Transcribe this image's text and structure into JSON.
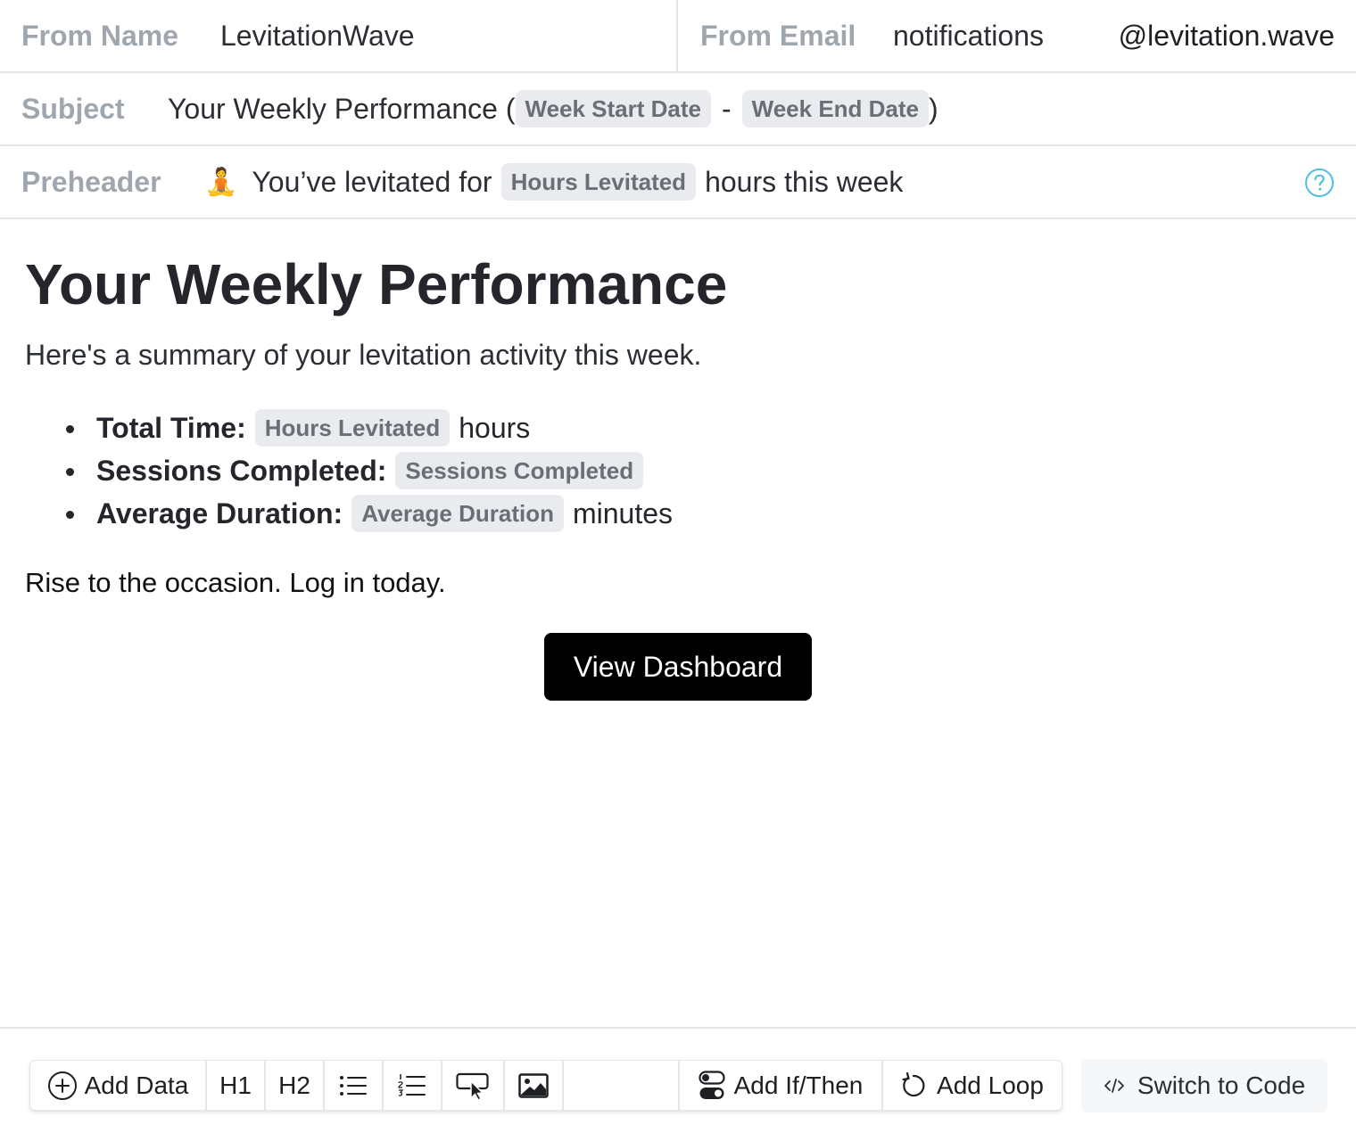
{
  "from": {
    "name_label": "From Name",
    "name_value": "LevitationWave",
    "email_label": "From Email",
    "email_local": "notifications",
    "email_domain": "@levitation.wave"
  },
  "subject": {
    "label": "Subject",
    "prefix": "Your Weekly Performance (",
    "chip_start": "Week Start Date",
    "separator": "-",
    "chip_end": "Week End Date",
    "suffix": ")"
  },
  "preheader": {
    "label": "Preheader",
    "emoji": "🧘",
    "prefix": "You’ve levitated for",
    "chip": "Hours Levitated",
    "suffix": "hours this week"
  },
  "body": {
    "heading": "Your Weekly Performance",
    "intro": "Here's a summary of your levitation activity this week.",
    "stats": [
      {
        "label": "Total Time:",
        "chip": "Hours Levitated",
        "suffix": "hours"
      },
      {
        "label": "Sessions Completed:",
        "chip": "Sessions Completed",
        "suffix": ""
      },
      {
        "label": "Average Duration:",
        "chip": "Average Duration",
        "suffix": "minutes"
      }
    ],
    "cta_text": "Rise to the occasion. Log in today.",
    "button_label": "View Dashboard"
  },
  "toolbar": {
    "add_data": "Add Data",
    "h1": "H1",
    "h2": "H2",
    "add_if_then": "Add If/Then",
    "add_loop": "Add Loop",
    "switch_to_code": "Switch to Code"
  },
  "icons": {
    "add_data": "plus-circle-icon",
    "bullet_list": "bullet-list-icon",
    "numbered_list": "numbered-list-icon",
    "button": "button-cursor-icon",
    "image": "image-icon",
    "if_then": "toggle-icon",
    "loop": "loop-icon",
    "code": "code-icon",
    "help": "help-icon"
  },
  "colors": {
    "label": "#a0a6ae",
    "chip_bg": "#eaebee",
    "chip_text": "#6a6f77",
    "button_bg": "#000000",
    "help_icon": "#4fbfe0"
  }
}
